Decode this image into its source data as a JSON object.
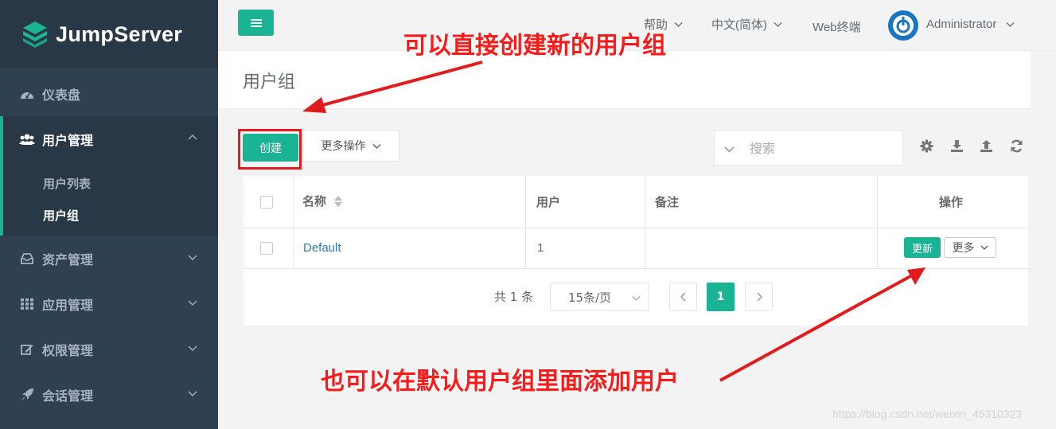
{
  "app": {
    "logo_text": "JumpServer"
  },
  "sidebar": {
    "items": [
      {
        "label": "仪表盘",
        "icon": "dashboard-icon"
      },
      {
        "label": "用户管理",
        "icon": "users-icon",
        "expanded": true,
        "children": [
          {
            "label": "用户列表"
          },
          {
            "label": "用户组",
            "current": true
          }
        ]
      },
      {
        "label": "资产管理",
        "icon": "inbox-icon"
      },
      {
        "label": "应用管理",
        "icon": "grid-icon"
      },
      {
        "label": "权限管理",
        "icon": "edit-icon"
      },
      {
        "label": "会话管理",
        "icon": "rocket-icon"
      }
    ]
  },
  "topbar": {
    "help": "帮助",
    "language": "中文(简体)",
    "web_terminal": "Web终端",
    "user": "Administrator"
  },
  "page": {
    "title": "用户组"
  },
  "toolbar": {
    "create_label": "创建",
    "more_actions_label": "更多操作",
    "search_placeholder": "搜索"
  },
  "table": {
    "columns": [
      "名称",
      "用户",
      "备注",
      "操作"
    ],
    "rows": [
      {
        "name": "Default",
        "users": "1",
        "comment": "",
        "update_label": "更新",
        "more_label": "更多"
      }
    ]
  },
  "pagination": {
    "total_text": "共 1 条",
    "page_size": "15条/页",
    "current_page": "1"
  },
  "annotations": {
    "top": "可以直接创建新的用户组",
    "bottom": "也可以在默认用户组里面添加用户"
  },
  "watermark": "https://blog.csdn.net/weixin_45310323",
  "colors": {
    "sidebar_bg": "#2f4050",
    "accent": "#1ab394",
    "annotation": "#ff1a1a",
    "link": "#337ab7"
  }
}
